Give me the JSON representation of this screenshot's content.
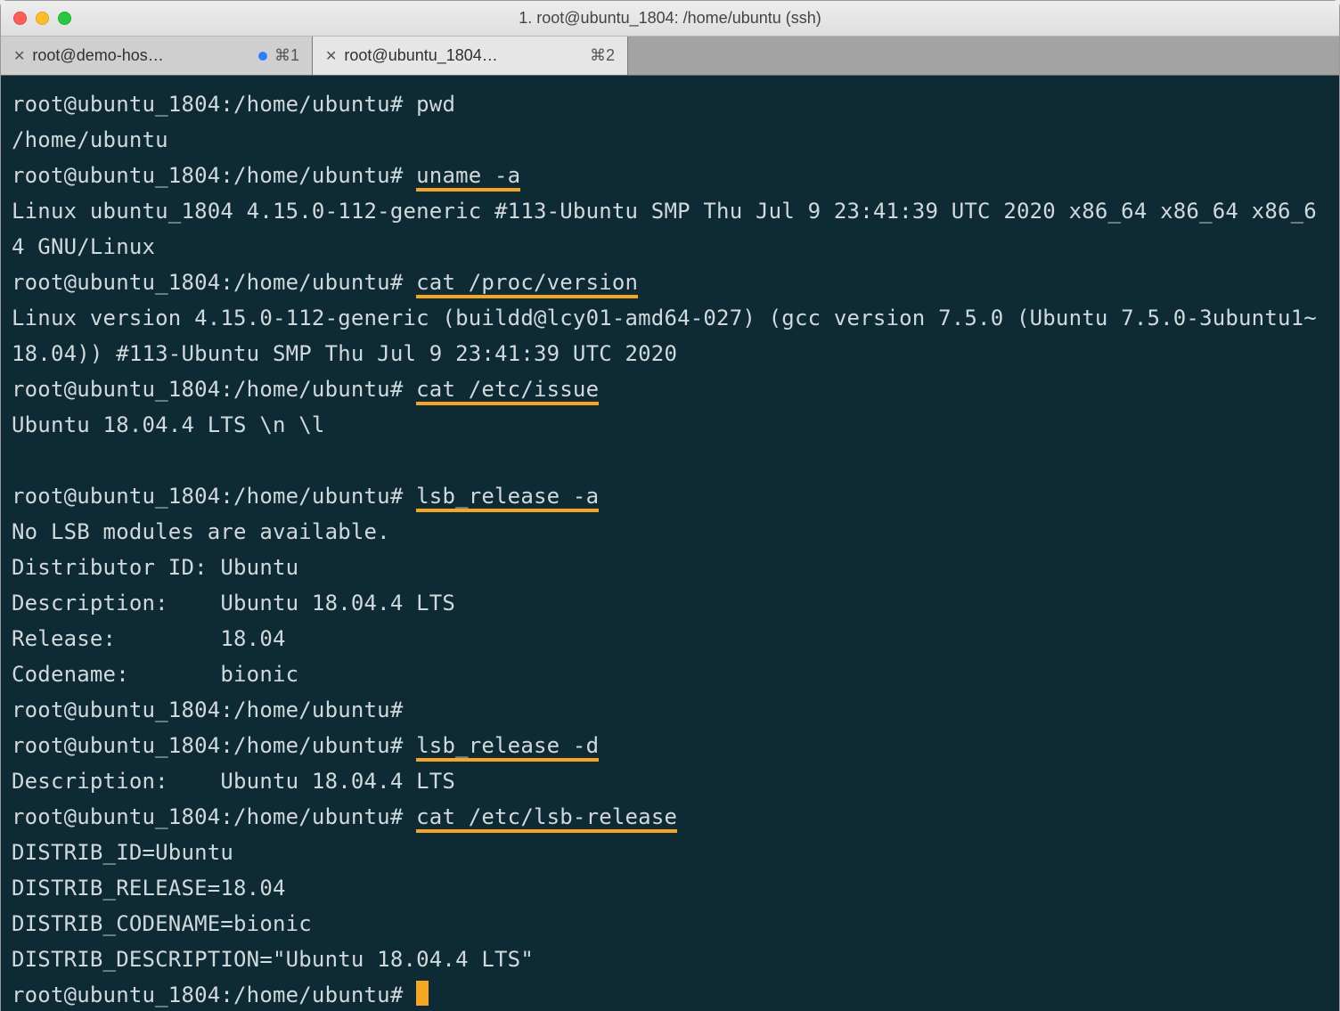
{
  "window": {
    "title": "1. root@ubuntu_1804: /home/ubuntu (ssh)"
  },
  "tabs": [
    {
      "label": "root@demo-hos…",
      "has_dot": true,
      "hotkey": "⌘1",
      "active": false
    },
    {
      "label": "root@ubuntu_1804…",
      "has_dot": false,
      "hotkey": "⌘2",
      "active": true
    }
  ],
  "prompt": "root@ubuntu_1804:/home/ubuntu#",
  "session": [
    {
      "type": "cmd",
      "text": "pwd"
    },
    {
      "type": "out",
      "text": "/home/ubuntu"
    },
    {
      "type": "cmd_hl",
      "text": "uname -a"
    },
    {
      "type": "out",
      "text": "Linux ubuntu_1804 4.15.0-112-generic #113-Ubuntu SMP Thu Jul 9 23:41:39 UTC 2020 x86_64 x86_64 x86_64 GNU/Linux"
    },
    {
      "type": "cmd_hl",
      "text": "cat /proc/version"
    },
    {
      "type": "out",
      "text": "Linux version 4.15.0-112-generic (buildd@lcy01-amd64-027) (gcc version 7.5.0 (Ubuntu 7.5.0-3ubuntu1~18.04)) #113-Ubuntu SMP Thu Jul 9 23:41:39 UTC 2020"
    },
    {
      "type": "cmd_hl",
      "text": "cat /etc/issue"
    },
    {
      "type": "out",
      "text": "Ubuntu 18.04.4 LTS \\n \\l"
    },
    {
      "type": "blank"
    },
    {
      "type": "cmd_hl",
      "text": "lsb_release -a"
    },
    {
      "type": "out",
      "text": "No LSB modules are available."
    },
    {
      "type": "out",
      "text": "Distributor ID: Ubuntu"
    },
    {
      "type": "out",
      "text": "Description:    Ubuntu 18.04.4 LTS"
    },
    {
      "type": "out",
      "text": "Release:        18.04"
    },
    {
      "type": "out",
      "text": "Codename:       bionic"
    },
    {
      "type": "cmd",
      "text": ""
    },
    {
      "type": "cmd_hl",
      "text": "lsb_release -d"
    },
    {
      "type": "out",
      "text": "Description:    Ubuntu 18.04.4 LTS"
    },
    {
      "type": "cmd_hl",
      "text": "cat /etc/lsb-release"
    },
    {
      "type": "out",
      "text": "DISTRIB_ID=Ubuntu"
    },
    {
      "type": "out",
      "text": "DISTRIB_RELEASE=18.04"
    },
    {
      "type": "out",
      "text": "DISTRIB_CODENAME=bionic"
    },
    {
      "type": "out",
      "text": "DISTRIB_DESCRIPTION=\"Ubuntu 18.04.4 LTS\""
    },
    {
      "type": "cursor"
    }
  ]
}
